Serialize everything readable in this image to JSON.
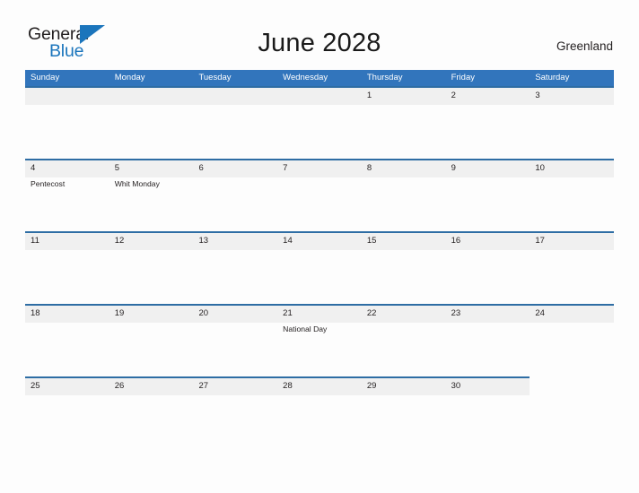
{
  "brand": {
    "name_part1": "General",
    "name_part2": "Blue",
    "flag_icon": "blue-triangle-flag-icon",
    "colors": {
      "dark_text": "#231F20",
      "blue": "#1B75BC"
    }
  },
  "header": {
    "title": "June 2028",
    "country": "Greenland"
  },
  "calendar": {
    "colors": {
      "header_blue": "#3275BC",
      "divider_blue": "#2E6DA4",
      "band_gray": "#F0F0F0",
      "text": "#231F20"
    },
    "weekdays": [
      "Sunday",
      "Monday",
      "Tuesday",
      "Wednesday",
      "Thursday",
      "Friday",
      "Saturday"
    ],
    "weeks": [
      {
        "band_columns": 7,
        "days": [
          {
            "num": "",
            "event": ""
          },
          {
            "num": "",
            "event": ""
          },
          {
            "num": "",
            "event": ""
          },
          {
            "num": "",
            "event": ""
          },
          {
            "num": "1",
            "event": ""
          },
          {
            "num": "2",
            "event": ""
          },
          {
            "num": "3",
            "event": ""
          }
        ]
      },
      {
        "band_columns": 7,
        "days": [
          {
            "num": "4",
            "event": "Pentecost"
          },
          {
            "num": "5",
            "event": "Whit Monday"
          },
          {
            "num": "6",
            "event": ""
          },
          {
            "num": "7",
            "event": ""
          },
          {
            "num": "8",
            "event": ""
          },
          {
            "num": "9",
            "event": ""
          },
          {
            "num": "10",
            "event": ""
          }
        ]
      },
      {
        "band_columns": 7,
        "days": [
          {
            "num": "11",
            "event": ""
          },
          {
            "num": "12",
            "event": ""
          },
          {
            "num": "13",
            "event": ""
          },
          {
            "num": "14",
            "event": ""
          },
          {
            "num": "15",
            "event": ""
          },
          {
            "num": "16",
            "event": ""
          },
          {
            "num": "17",
            "event": ""
          }
        ]
      },
      {
        "band_columns": 7,
        "days": [
          {
            "num": "18",
            "event": ""
          },
          {
            "num": "19",
            "event": ""
          },
          {
            "num": "20",
            "event": ""
          },
          {
            "num": "21",
            "event": "National Day"
          },
          {
            "num": "22",
            "event": ""
          },
          {
            "num": "23",
            "event": ""
          },
          {
            "num": "24",
            "event": ""
          }
        ]
      },
      {
        "band_columns": 6,
        "days": [
          {
            "num": "25",
            "event": ""
          },
          {
            "num": "26",
            "event": ""
          },
          {
            "num": "27",
            "event": ""
          },
          {
            "num": "28",
            "event": ""
          },
          {
            "num": "29",
            "event": ""
          },
          {
            "num": "30",
            "event": ""
          },
          {
            "num": "",
            "event": ""
          }
        ]
      }
    ]
  }
}
